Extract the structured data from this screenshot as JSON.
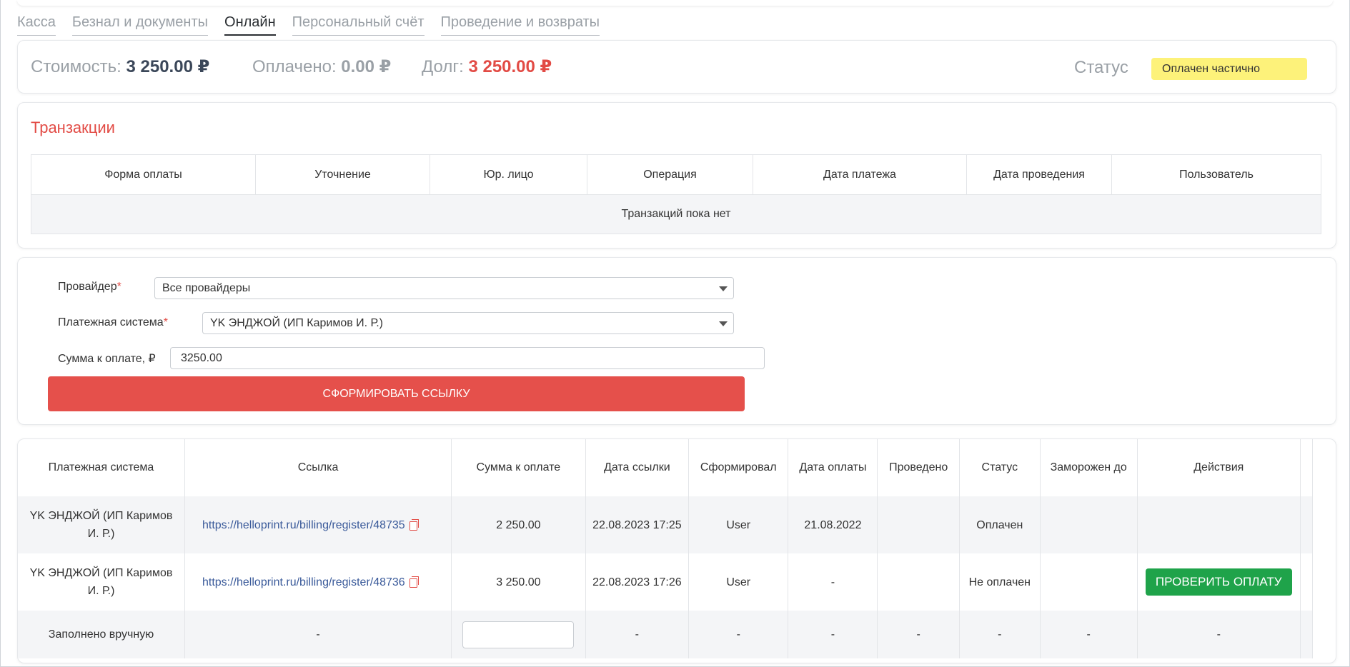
{
  "tabs": [
    {
      "label": "Касса"
    },
    {
      "label": "Безнал и документы"
    },
    {
      "label": "Онлайн",
      "active": true
    },
    {
      "label": "Персональный счёт"
    },
    {
      "label": "Проведение и возвраты"
    }
  ],
  "summary": {
    "cost_label": "Стоимость:",
    "cost_value": "3 250.00 ₽",
    "paid_label": "Оплачено:",
    "paid_value": "0.00 ₽",
    "debt_label": "Долг:",
    "debt_value": "3 250.00 ₽",
    "status_label": "Статус",
    "status_value": "Оплачен частично"
  },
  "transactions": {
    "title": "Транзакции",
    "columns": [
      "Форма оплаты",
      "Уточнение",
      "Юр. лицо",
      "Операция",
      "Дата платежа",
      "Дата проведения",
      "Пользователь"
    ],
    "empty_text": "Транзакций пока нет"
  },
  "form": {
    "provider_label": "Провайдер",
    "provider_value": "Все провайдеры",
    "system_label": "Платежная система",
    "system_value": "YK ЭНДЖОЙ (ИП Каримов И. Р.)",
    "amount_label": "Сумма к оплате, ₽",
    "amount_value": "3250.00",
    "submit_label": "СФОРМИРОВАТЬ ССЫЛКУ"
  },
  "links": {
    "columns": [
      "Платежная система",
      "Ссылка",
      "Сумма к оплате",
      "Дата ссылки",
      "Сформировал",
      "Дата оплаты",
      "Проведено",
      "Статус",
      "Заморожен до",
      "Действия"
    ],
    "rows": [
      {
        "system": "YK ЭНДЖОЙ (ИП Каримов И. Р.)",
        "link": "https://helloprint.ru/billing/register/48735",
        "amount": "2 250.00",
        "link_date": "22.08.2023 17:25",
        "author": "User",
        "pay_date": "21.08.2022",
        "posted": "",
        "status": "Оплачен",
        "frozen": "",
        "action": ""
      },
      {
        "system": "YK ЭНДЖОЙ (ИП Каримов И. Р.)",
        "link": "https://helloprint.ru/billing/register/48736",
        "amount": "3 250.00",
        "link_date": "22.08.2023 17:26",
        "author": "User",
        "pay_date": "-",
        "posted": "",
        "status": "Не оплачен",
        "frozen": "",
        "action": "ПРОВЕРИТЬ ОПЛАТУ"
      }
    ],
    "manual_row": {
      "system": "Заполнено вручную",
      "link": "-",
      "link_date": "-",
      "author": "-",
      "pay_date": "-",
      "posted": "-",
      "status": "-",
      "frozen": "-",
      "action": "-"
    }
  },
  "colors": {
    "accent_red": "#e24b45",
    "button_red": "#e5504b",
    "button_green": "#1fa34a",
    "status_yellow": "#fdf27a",
    "link_blue": "#3a5a9a"
  }
}
